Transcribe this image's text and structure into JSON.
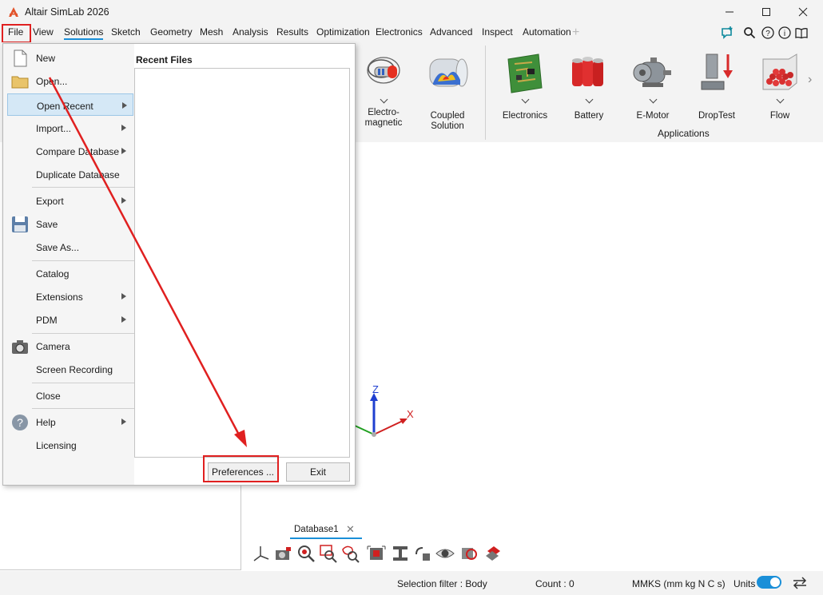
{
  "app": {
    "title": "Altair SimLab 2026"
  },
  "colors": {
    "accent": "#1a8fd8",
    "annotation": "#e02020",
    "menu_highlight": "#d5e8f6"
  },
  "menubar": {
    "items": [
      "File",
      "View",
      "Solutions",
      "Sketch",
      "Geometry",
      "Mesh",
      "Analysis",
      "Results",
      "Optimization",
      "Electronics",
      "Advanced",
      "Inspect",
      "Automation"
    ],
    "active": "Solutions",
    "right_icons": [
      "feedback-icon",
      "search-icon",
      "help-icon",
      "info-icon",
      "book-icon"
    ]
  },
  "ribbon": {
    "solutions": [
      {
        "label": "Electro-\nmagnetic",
        "icon": "electromagnetic-icon"
      },
      {
        "label": "Coupled Solution",
        "icon": "coupled-solution-icon"
      }
    ],
    "applications": [
      {
        "label": "Electronics",
        "icon": "circuit-board-icon"
      },
      {
        "label": "Battery",
        "icon": "battery-icon"
      },
      {
        "label": "E-Motor",
        "icon": "motor-icon"
      },
      {
        "label": "DropTest",
        "icon": "droptest-icon"
      },
      {
        "label": "Flow",
        "icon": "flow-icon"
      }
    ],
    "group_label": "Applications"
  },
  "file_menu": {
    "items": [
      {
        "label": "New",
        "icon": "new-document-icon",
        "submenu": false
      },
      {
        "label": "Open...",
        "icon": "folder-icon",
        "submenu": false
      },
      {
        "label": "Open Recent",
        "icon": "",
        "submenu": true,
        "highlighted": true
      },
      {
        "label": "Import...",
        "icon": "",
        "submenu": true
      },
      {
        "label": "Compare Database",
        "icon": "",
        "submenu": true
      },
      {
        "label": "Duplicate Database",
        "icon": "",
        "submenu": false
      },
      {
        "label": "Export",
        "icon": "",
        "submenu": true
      },
      {
        "label": "Save",
        "icon": "floppy-disk-icon",
        "submenu": false
      },
      {
        "label": "Save As...",
        "icon": "",
        "submenu": false
      },
      {
        "label": "Catalog",
        "icon": "",
        "submenu": false
      },
      {
        "label": "Extensions",
        "icon": "",
        "submenu": true
      },
      {
        "label": "PDM",
        "icon": "",
        "submenu": true
      },
      {
        "label": "Camera",
        "icon": "camera-icon",
        "submenu": false
      },
      {
        "label": "Screen Recording",
        "icon": "",
        "submenu": false
      },
      {
        "label": "Close",
        "icon": "",
        "submenu": false
      },
      {
        "label": "Help",
        "icon": "help-icon",
        "submenu": true
      },
      {
        "label": "Licensing",
        "icon": "",
        "submenu": false
      }
    ],
    "recent_files_title": "Recent Files",
    "recent_files": [],
    "preferences_label": "Preferences ...",
    "exit_label": "Exit"
  },
  "viewport": {
    "triad_labels": {
      "z": "Z",
      "x": "X"
    },
    "tab_label": "Database1"
  },
  "statusbar": {
    "selection_filter": "Selection filter : Body",
    "count": "Count : 0",
    "units_system": "MMKS (mm kg N C s)",
    "units_label": "Units",
    "units_toggle_on": true
  }
}
